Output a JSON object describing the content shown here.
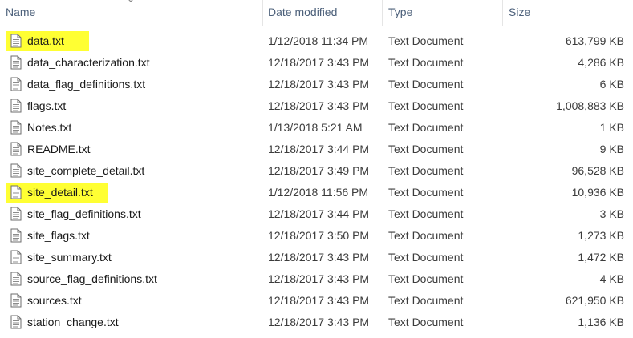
{
  "columns": {
    "name": "Name",
    "date": "Date modified",
    "type": "Type",
    "size": "Size"
  },
  "files": [
    {
      "name": "data.txt",
      "date": "1/12/2018 11:34 PM",
      "type": "Text Document",
      "size": "613,799 KB",
      "highlighted": true
    },
    {
      "name": "data_characterization.txt",
      "date": "12/18/2017 3:43 PM",
      "type": "Text Document",
      "size": "4,286 KB",
      "highlighted": false
    },
    {
      "name": "data_flag_definitions.txt",
      "date": "12/18/2017 3:43 PM",
      "type": "Text Document",
      "size": "6 KB",
      "highlighted": false
    },
    {
      "name": "flags.txt",
      "date": "12/18/2017 3:43 PM",
      "type": "Text Document",
      "size": "1,008,883 KB",
      "highlighted": false
    },
    {
      "name": "Notes.txt",
      "date": "1/13/2018 5:21 AM",
      "type": "Text Document",
      "size": "1 KB",
      "highlighted": false
    },
    {
      "name": "README.txt",
      "date": "12/18/2017 3:44 PM",
      "type": "Text Document",
      "size": "9 KB",
      "highlighted": false
    },
    {
      "name": "site_complete_detail.txt",
      "date": "12/18/2017 3:49 PM",
      "type": "Text Document",
      "size": "96,528 KB",
      "highlighted": false
    },
    {
      "name": "site_detail.txt",
      "date": "1/12/2018 11:56 PM",
      "type": "Text Document",
      "size": "10,936 KB",
      "highlighted": true
    },
    {
      "name": "site_flag_definitions.txt",
      "date": "12/18/2017 3:44 PM",
      "type": "Text Document",
      "size": "3 KB",
      "highlighted": false
    },
    {
      "name": "site_flags.txt",
      "date": "12/18/2017 3:50 PM",
      "type": "Text Document",
      "size": "1,273 KB",
      "highlighted": false
    },
    {
      "name": "site_summary.txt",
      "date": "12/18/2017 3:43 PM",
      "type": "Text Document",
      "size": "1,472 KB",
      "highlighted": false
    },
    {
      "name": "source_flag_definitions.txt",
      "date": "12/18/2017 3:43 PM",
      "type": "Text Document",
      "size": "4 KB",
      "highlighted": false
    },
    {
      "name": "sources.txt",
      "date": "12/18/2017 3:43 PM",
      "type": "Text Document",
      "size": "621,950 KB",
      "highlighted": false
    },
    {
      "name": "station_change.txt",
      "date": "12/18/2017 3:43 PM",
      "type": "Text Document",
      "size": "1,136 KB",
      "highlighted": false
    }
  ],
  "icons": {
    "file": "text-document-icon",
    "sort": "sort-chevron-icon"
  },
  "colors": {
    "highlight": "#ffff33",
    "header_text": "#4c607a"
  }
}
